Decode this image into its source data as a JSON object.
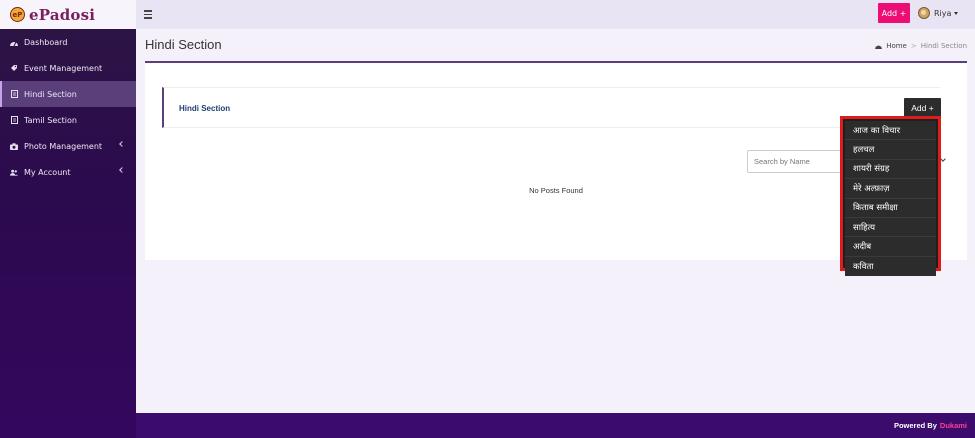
{
  "app": {
    "logo_mark": "eP",
    "logo_text": "ePadosi"
  },
  "header": {
    "add_label": "Add +",
    "user_name": "Riya"
  },
  "sidebar": {
    "items": [
      {
        "label": "Dashboard",
        "icon": "dashboard-icon"
      },
      {
        "label": "Event Management",
        "icon": "tag-icon"
      },
      {
        "label": "Hindi Section",
        "icon": "book-icon"
      },
      {
        "label": "Tamil Section",
        "icon": "book-icon"
      },
      {
        "label": "Photo Management",
        "icon": "camera-icon"
      },
      {
        "label": "My Account",
        "icon": "users-icon"
      }
    ]
  },
  "main": {
    "page_title": "Hindi Section",
    "breadcrumb": {
      "home": "Home",
      "current": "Hindi Section"
    },
    "section_title": "Hindi Section",
    "add_label": "Add +",
    "search_placeholder": "Search by Name",
    "empty_text": "No Posts Found"
  },
  "dropdown": {
    "items": [
      "आज का विचार",
      "हलचल",
      "शायरी संग्रह",
      "मेरे अल्फ़ाज़",
      "किताब समीक्षा",
      "साहित्य",
      "अदीब",
      "कविता"
    ]
  },
  "footer": {
    "prefix": "Powered By",
    "brand": "Dukami"
  },
  "colors": {
    "sidebar_bg": "#2c0a4e",
    "accent": "#ec0e74",
    "highlight": "#e01b1b"
  }
}
